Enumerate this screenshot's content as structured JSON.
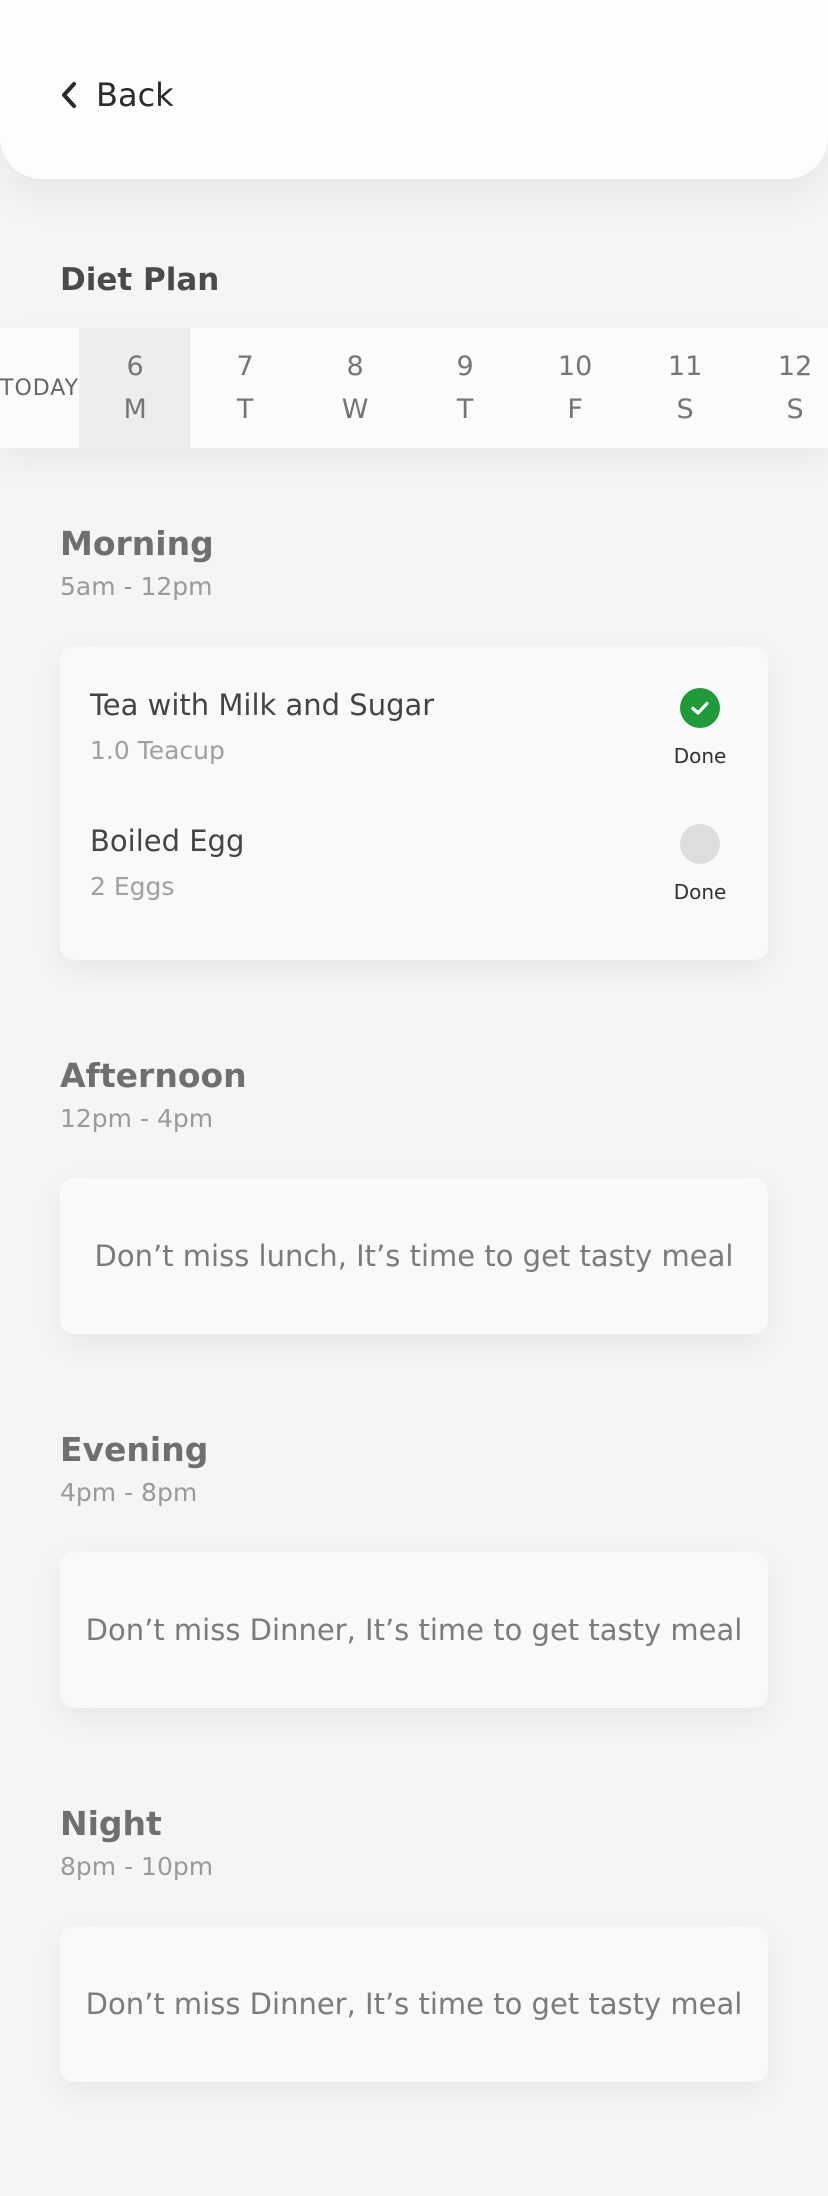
{
  "header": {
    "back_label": "Back"
  },
  "page": {
    "title": "Diet Plan"
  },
  "calendar": {
    "today_label": "TODAY",
    "days": [
      {
        "date": "6",
        "weekday": "M",
        "selected": true
      },
      {
        "date": "7",
        "weekday": "T"
      },
      {
        "date": "8",
        "weekday": "W"
      },
      {
        "date": "9",
        "weekday": "T"
      },
      {
        "date": "10",
        "weekday": "F"
      },
      {
        "date": "11",
        "weekday": "S"
      },
      {
        "date": "12",
        "weekday": "S"
      }
    ]
  },
  "sections": {
    "morning": {
      "title": "Morning",
      "time": "5am - 12pm",
      "items": [
        {
          "name": "Tea with Milk and Sugar",
          "quantity": "1.0 Teacup",
          "done_label": "Done",
          "done": true
        },
        {
          "name": "Boiled Egg",
          "quantity": "2 Eggs",
          "done_label": "Done",
          "done": false
        }
      ]
    },
    "afternoon": {
      "title": "Afternoon",
      "time": "12pm - 4pm",
      "message": "Don’t miss lunch, It’s time to get tasty meal"
    },
    "evening": {
      "title": "Evening",
      "time": "4pm - 8pm",
      "message": "Don’t miss Dinner, It’s time to get tasty meal"
    },
    "night": {
      "title": "Night",
      "time": "8pm - 10pm",
      "message": "Don’t miss Dinner, It’s time to get tasty meal"
    }
  },
  "colors": {
    "done_green": "#1f9b3b",
    "selected_day_bg": "#ededed"
  },
  "icons": {
    "back": "chevron-left-icon",
    "done": "checkmark-icon"
  }
}
